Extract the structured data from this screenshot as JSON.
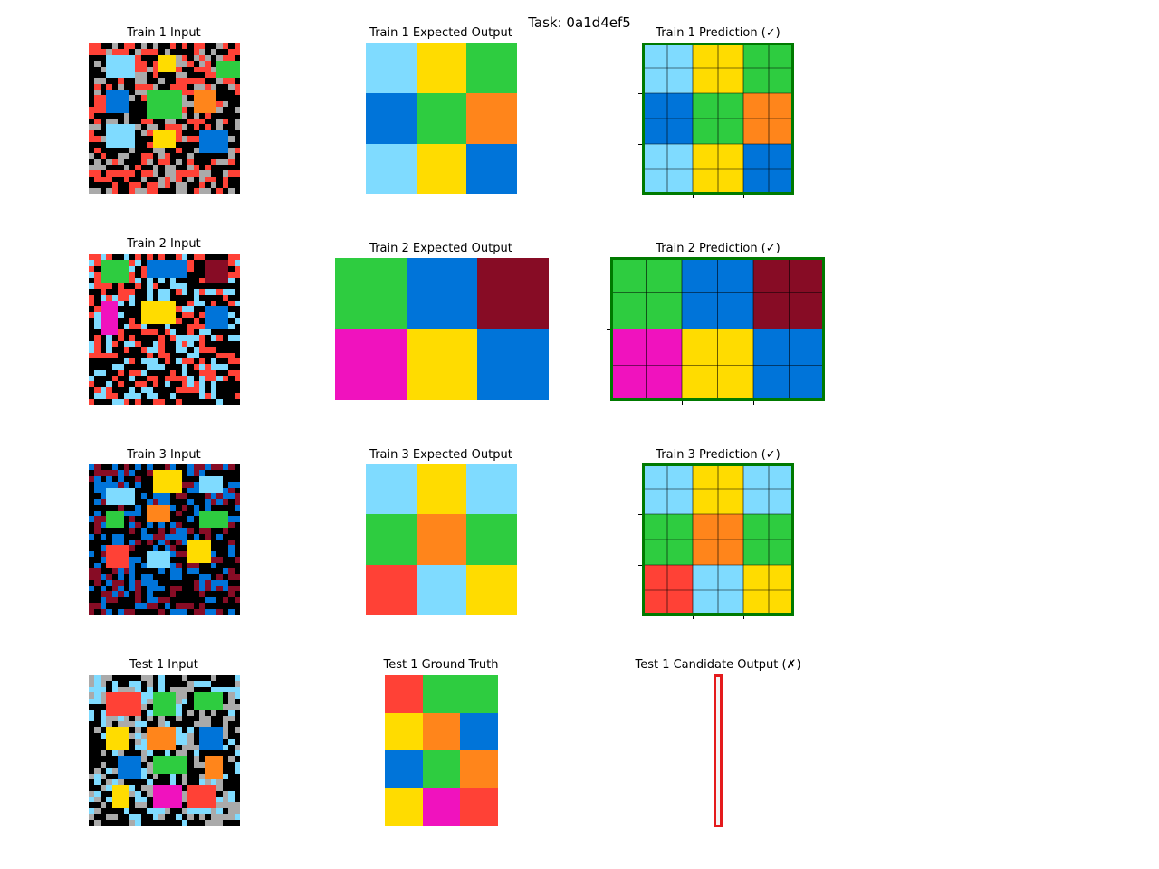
{
  "title": "Task: 0a1d4ef5",
  "palette": {
    "0": "#000000",
    "1": "#0074D9",
    "2": "#FF4136",
    "3": "#2ECC40",
    "4": "#FFDC00",
    "5": "#AAAAAA",
    "6": "#F012BE",
    "7": "#FF851B",
    "8": "#7FDBFF",
    "9": "#870C25"
  },
  "border_colors": {
    "correct": "#007a00",
    "wrong": "#e41a1c"
  },
  "rows": [
    {
      "input": {
        "label": "Train 1 Input",
        "noise": [
          0,
          2,
          5
        ],
        "size": 26,
        "blocks": [
          [
            2,
            3,
            6,
            8,
            8
          ],
          [
            2,
            12,
            5,
            15,
            4
          ],
          [
            3,
            22,
            6,
            26,
            3
          ],
          [
            8,
            3,
            12,
            7,
            1
          ],
          [
            8,
            10,
            13,
            16,
            3
          ],
          [
            8,
            18,
            12,
            22,
            7
          ],
          [
            14,
            3,
            18,
            8,
            8
          ],
          [
            15,
            11,
            18,
            15,
            4
          ],
          [
            15,
            19,
            19,
            24,
            1
          ]
        ]
      },
      "expected": {
        "label": "Train 1 Expected Output",
        "grid": [
          [
            8,
            4,
            3
          ],
          [
            1,
            3,
            7
          ],
          [
            8,
            4,
            1
          ]
        ]
      },
      "prediction": {
        "label": "Train 1 Prediction (✓)",
        "status": "correct",
        "grid": [
          [
            8,
            4,
            3
          ],
          [
            1,
            3,
            7
          ],
          [
            8,
            4,
            1
          ]
        ]
      }
    },
    {
      "input": {
        "label": "Train 2 Input",
        "noise": [
          0,
          2,
          8
        ],
        "size": 26,
        "blocks": [
          [
            1,
            2,
            5,
            7,
            3
          ],
          [
            1,
            10,
            4,
            17,
            1
          ],
          [
            1,
            20,
            5,
            24,
            9
          ],
          [
            8,
            2,
            14,
            5,
            6
          ],
          [
            8,
            9,
            12,
            15,
            4
          ],
          [
            9,
            20,
            13,
            24,
            1
          ]
        ]
      },
      "expected": {
        "label": "Train 2 Expected Output",
        "grid": [
          [
            3,
            1,
            9
          ],
          [
            6,
            4,
            1
          ]
        ]
      },
      "prediction": {
        "label": "Train 2 Prediction (✓)",
        "status": "correct",
        "grid": [
          [
            3,
            1,
            9
          ],
          [
            6,
            4,
            1
          ]
        ]
      }
    },
    {
      "input": {
        "label": "Train 3 Input",
        "noise": [
          0,
          1,
          9
        ],
        "size": 26,
        "blocks": [
          [
            1,
            11,
            5,
            16,
            4
          ],
          [
            2,
            19,
            5,
            23,
            8
          ],
          [
            4,
            3,
            7,
            8,
            8
          ],
          [
            7,
            10,
            10,
            14,
            7
          ],
          [
            8,
            3,
            11,
            6,
            3
          ],
          [
            8,
            19,
            11,
            24,
            3
          ],
          [
            13,
            17,
            17,
            21,
            4
          ],
          [
            14,
            3,
            18,
            7,
            2
          ],
          [
            15,
            10,
            18,
            14,
            8
          ]
        ]
      },
      "expected": {
        "label": "Train 3 Expected Output",
        "grid": [
          [
            8,
            4,
            8
          ],
          [
            3,
            7,
            3
          ],
          [
            2,
            8,
            4
          ]
        ]
      },
      "prediction": {
        "label": "Train 3 Prediction (✓)",
        "status": "correct",
        "grid": [
          [
            8,
            4,
            8
          ],
          [
            3,
            7,
            3
          ],
          [
            2,
            8,
            4
          ]
        ]
      }
    },
    {
      "input": {
        "label": "Test 1 Input",
        "noise": [
          0,
          5,
          8
        ],
        "size": 26,
        "blocks": [
          [
            3,
            3,
            7,
            9,
            2
          ],
          [
            3,
            11,
            7,
            15,
            3
          ],
          [
            3,
            18,
            6,
            23,
            3
          ],
          [
            9,
            3,
            13,
            7,
            4
          ],
          [
            9,
            10,
            13,
            15,
            7
          ],
          [
            9,
            19,
            13,
            23,
            1
          ],
          [
            14,
            5,
            18,
            9,
            1
          ],
          [
            14,
            11,
            17,
            17,
            3
          ],
          [
            14,
            20,
            18,
            23,
            7
          ],
          [
            19,
            4,
            23,
            7,
            4
          ],
          [
            19,
            11,
            23,
            16,
            6
          ],
          [
            19,
            17,
            23,
            22,
            2
          ]
        ]
      },
      "expected": {
        "label": "Test 1 Ground Truth",
        "grid": [
          [
            2,
            3,
            3
          ],
          [
            4,
            7,
            1
          ],
          [
            1,
            3,
            7
          ],
          [
            4,
            6,
            2
          ]
        ]
      },
      "prediction": {
        "label": "Test 1 Candidate Output (✗)",
        "status": "wrong",
        "grid": []
      }
    }
  ]
}
